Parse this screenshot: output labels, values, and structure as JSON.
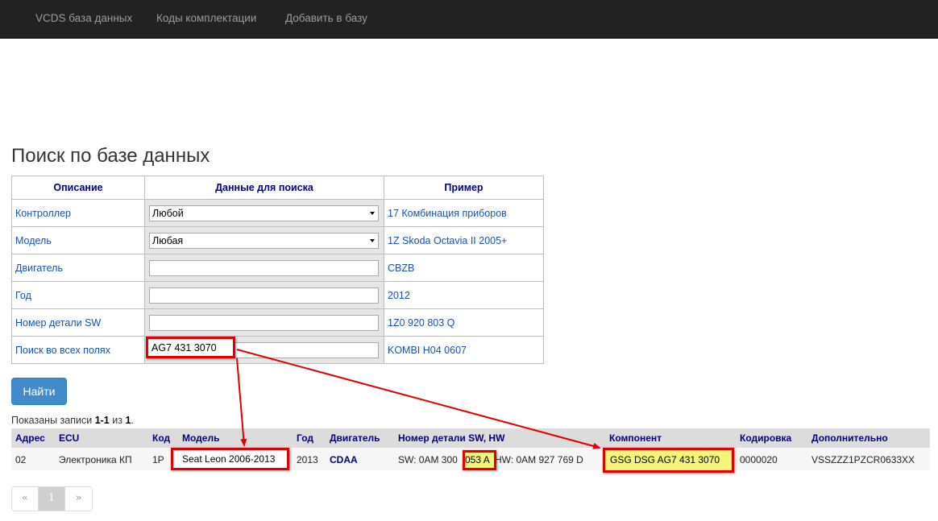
{
  "nav": {
    "items": [
      "VCDS база данных",
      "Коды комплектации",
      "Добавить в базу"
    ]
  },
  "page": {
    "title": "Поиск по базе данных"
  },
  "search_form": {
    "headers": [
      "Описание",
      "Данные для поиска",
      "Пример"
    ],
    "rows": [
      {
        "label": "Контроллер",
        "type": "select",
        "value": "Любой",
        "example": "17 Комбинация приборов"
      },
      {
        "label": "Модель",
        "type": "select",
        "value": "Любая",
        "example": "1Z Skoda Octavia II 2005+"
      },
      {
        "label": "Двигатель",
        "type": "input",
        "value": "",
        "example": "CBZB"
      },
      {
        "label": "Год",
        "type": "input",
        "value": "",
        "example": "2012"
      },
      {
        "label": "Номер детали SW",
        "type": "input",
        "value": "",
        "example": "1Z0 920 803 Q"
      },
      {
        "label": "Поиск во всех полях",
        "type": "input",
        "value": "AG7 431 3070",
        "example": "KOMBI H04 0607"
      }
    ],
    "submit_label": "Найти"
  },
  "summary": {
    "prefix": "Показаны записи ",
    "range": "1-1",
    "middle": " из ",
    "total": "1",
    "suffix": "."
  },
  "results": {
    "headers": [
      "Адрес",
      "ECU",
      "Код",
      "Модель",
      "Год",
      "Двигатель",
      "Номер детали SW, HW",
      "Компонент",
      "Кодировка",
      "Дополнительно"
    ],
    "row": {
      "address": "02",
      "ecu": "Электроника КП",
      "code": "1P",
      "model": "Seat Leon 2006-2013",
      "year": "2013",
      "engine": "CDAA",
      "sw_part_a": "SW: 0AM 300 ",
      "sw_part_b": "053 A",
      "hw_part": "HW: 0AM 927 769 D",
      "component": "GSG DSG AG7 431 3070",
      "coding": "0000020",
      "extra": "VSSZZZ1PZCR0633XX"
    }
  },
  "pagination": {
    "prev": "«",
    "current": "1",
    "next": "»"
  },
  "colors": {
    "navbar": "#222222",
    "link": "#1a52a8",
    "header_text": "#000080",
    "button": "#428bca",
    "annotation_red": "#e00000",
    "highlight_yellow": "#f5f57a"
  }
}
